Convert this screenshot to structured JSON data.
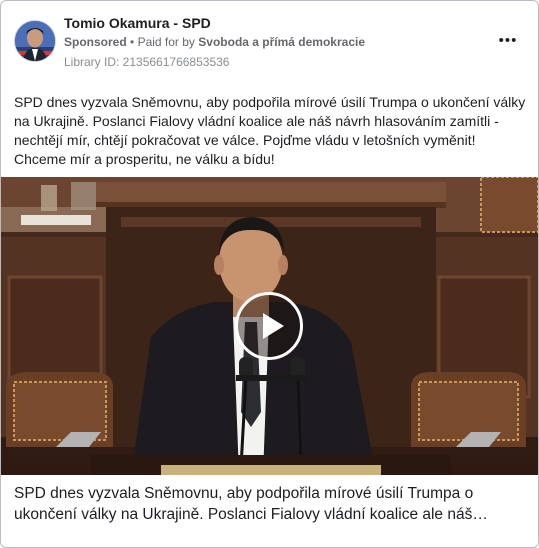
{
  "ad": {
    "page_name": "Tomio Okamura - SPD",
    "sponsored_label": "Sponsored",
    "separator": "•",
    "paid_for_label": "Paid for by",
    "advertiser": "Svoboda a přímá demokracie",
    "library_id": "Library ID: 2135661766853536",
    "more_icon": "•••",
    "body_text": "SPD dnes vyzvala Sněmovnu, aby podpořila mírové úsilí Trumpa o ukončení války na Ukrajině. Poslanci Fialovy vládní koalice ale náš návrh hlasováním zamítli - nechtějí mír, chtějí pokračovat ve válce. Pojďme vládu v letošních vyměnit! Chceme mír a prosperitu, ne válku a bídu!",
    "caption_line1": "SPD dnes vyzvala Sněmovnu, aby podpořila mírové úsilí Trumpa o",
    "caption_line2": "ukončení války na Ukrajině. Poslanci Fialovy vládní koalice ale náš…"
  },
  "icons": {
    "more": "more-horizontal-icon",
    "play": "play-icon"
  },
  "colors": {
    "text_primary": "#1c1e21",
    "text_secondary": "#65676b",
    "card_border": "#b9bcc2"
  }
}
